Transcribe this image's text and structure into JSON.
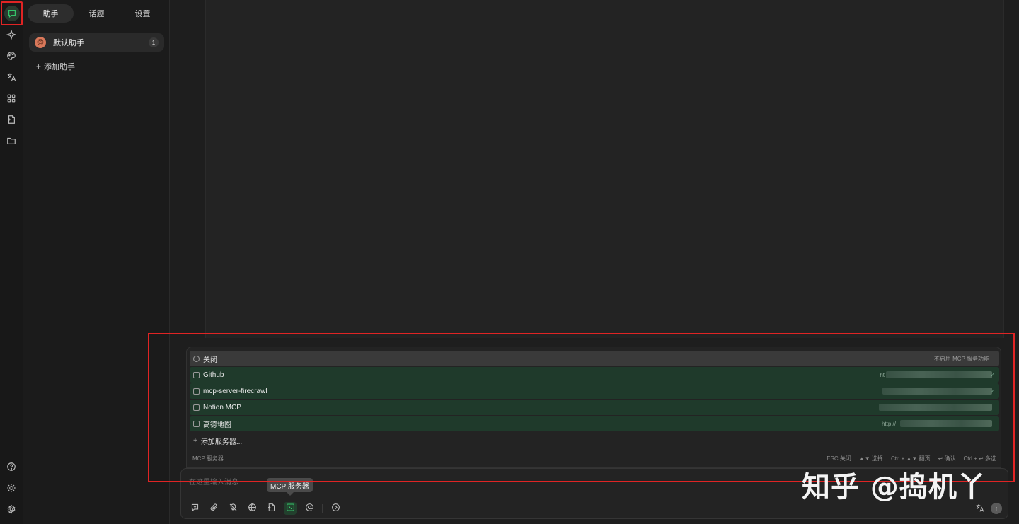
{
  "sidebar": {
    "tabs": [
      {
        "label": "助手"
      },
      {
        "label": "话题"
      },
      {
        "label": "设置"
      }
    ],
    "assistant": {
      "name": "默认助手",
      "avatar": "😊",
      "count": "1"
    },
    "add_assistant": "添加助手"
  },
  "mcp": {
    "close": {
      "label": "关闭",
      "note": "不启用 MCP 服务功能"
    },
    "servers": [
      {
        "name": "Github",
        "hint": "ht"
      },
      {
        "name": "mcp-server-firecrawl",
        "hint": ""
      },
      {
        "name": "Notion MCP",
        "hint": ""
      },
      {
        "name": "高德地图",
        "hint": "http://"
      }
    ],
    "add_server": "添加服务器...",
    "footer_label": "MCP 服务器",
    "shortcuts": [
      "ESC 关闭",
      "▲▼ 选择",
      "Ctrl + ▲▼ 翻页",
      "↩ 确认",
      "Ctrl + ↩ 多选"
    ]
  },
  "input": {
    "placeholder": "在这里输入消息"
  },
  "tooltip": "MCP 服务器",
  "watermark": "知乎 @捣机丫",
  "icons": {
    "rail": [
      "chat-icon",
      "sparkle-icon",
      "palette-icon",
      "translate-icon",
      "apps-icon",
      "file-icon",
      "folder-icon",
      "help-icon",
      "sun-icon",
      "gear-icon"
    ],
    "toolbar": [
      "new-topic-icon",
      "paperclip-icon",
      "bulb-off-icon",
      "globe-icon",
      "document-icon",
      "terminal-icon",
      "at-icon",
      "arrow-circle-icon"
    ]
  },
  "colors": {
    "accent": "#34c46a",
    "highlight": "#e02424",
    "server_row": "#1f3a2b"
  }
}
